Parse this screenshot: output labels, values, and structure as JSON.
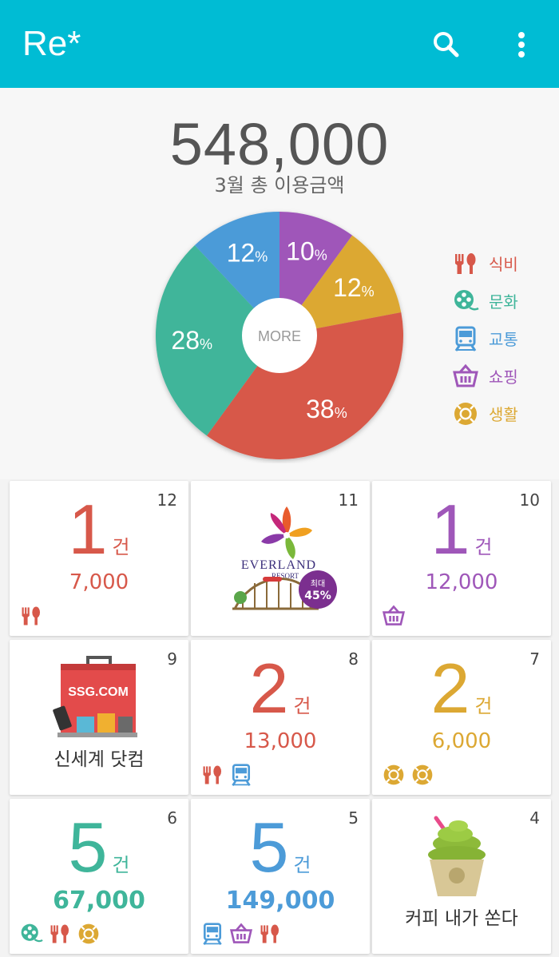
{
  "app": {
    "title": "Re*"
  },
  "summary": {
    "total": "548,000",
    "label": "3월 총 이용금액",
    "more_label": "MORE"
  },
  "chart_data": {
    "type": "pie",
    "slices": [
      {
        "category": "식비",
        "value": 38,
        "color": "#d7584a"
      },
      {
        "category": "문화",
        "value": 28,
        "color": "#3fb59a"
      },
      {
        "category": "교통",
        "value": 12,
        "color": "#4c9bd8"
      },
      {
        "category": "쇼핑",
        "value": 10,
        "color": "#9f57b9"
      },
      {
        "category": "생활",
        "value": 12,
        "color": "#dca833"
      }
    ],
    "unit": "%"
  },
  "legend": [
    {
      "label": "식비",
      "icon": "fork-knife-icon",
      "color": "#d7584a"
    },
    {
      "label": "문화",
      "icon": "film-reel-icon",
      "color": "#3fb59a"
    },
    {
      "label": "교통",
      "icon": "train-icon",
      "color": "#4c9bd8"
    },
    {
      "label": "쇼핑",
      "icon": "basket-icon",
      "color": "#9f57b9"
    },
    {
      "label": "생활",
      "icon": "lifebuoy-icon",
      "color": "#dca833"
    }
  ],
  "cards": {
    "c12": {
      "num": "12",
      "count": "1",
      "unit": "건",
      "amount": "7,000",
      "color": "#d7584a"
    },
    "c11": {
      "num": "11",
      "brand": "EVERLAND",
      "sub": "RESORT",
      "badge_top": "최대",
      "badge_bottom": "45%"
    },
    "c10": {
      "num": "10",
      "count": "1",
      "unit": "건",
      "amount": "12,000",
      "color": "#9f57b9"
    },
    "c9": {
      "num": "9",
      "brand": "SSG.COM",
      "label": "신세계 닷컴"
    },
    "c8": {
      "num": "8",
      "count": "2",
      "unit": "건",
      "amount": "13,000",
      "color": "#d7584a"
    },
    "c7": {
      "num": "7",
      "count": "2",
      "unit": "건",
      "amount": "6,000",
      "color": "#dca833"
    },
    "c6": {
      "num": "6",
      "count": "5",
      "unit": "건",
      "amount": "67,000",
      "color": "#3fb59a"
    },
    "c5": {
      "num": "5",
      "count": "5",
      "unit": "건",
      "amount": "149,000",
      "color": "#4c9bd8"
    },
    "c4": {
      "num": "4",
      "label": "커피 내가 쏜다"
    }
  },
  "colors": {
    "appbar": "#00bcd4",
    "food": "#d7584a",
    "culture": "#3fb59a",
    "transit": "#4c9bd8",
    "shopping": "#9f57b9",
    "living": "#dca833"
  }
}
